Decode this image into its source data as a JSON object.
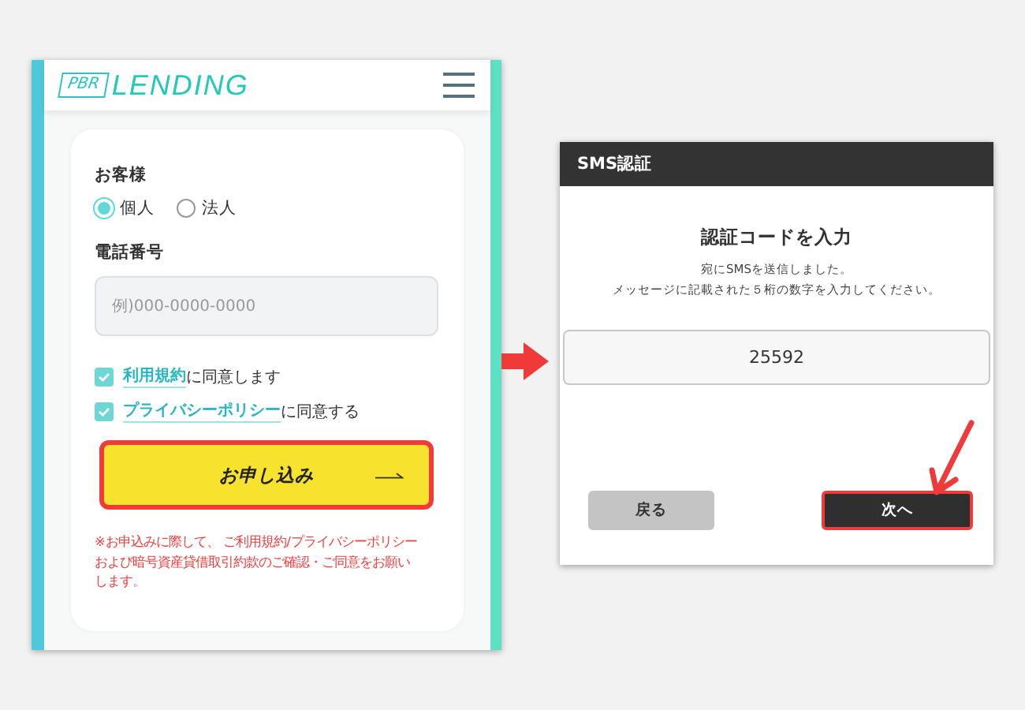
{
  "left_screen": {
    "logo_badge": "PBR",
    "logo_text": "LENDING",
    "customer_label": "お客様",
    "customer_types": [
      {
        "label": "個人",
        "selected": true
      },
      {
        "label": "法人",
        "selected": false
      }
    ],
    "phone_label": "電話番号",
    "phone_field": {
      "placeholder": "例)000-0000-0000"
    },
    "agreements": [
      {
        "link": "利用規約",
        "text": "に同意します",
        "checked": true
      },
      {
        "link": "プライバシーポリシー",
        "text": "に同意する",
        "checked": true
      }
    ],
    "apply_button": {
      "label": "お申し込み",
      "highlighted": true
    },
    "notice": "※お申込みに際して、 ご利用規約/プライバシーポリシーおよび暗号資産貸借取引約款のご確認・ご同意をお願いします。"
  },
  "right_screen": {
    "title": "SMS認証",
    "heading": "認証コードを入力",
    "message_lines": [
      "宛にSMSを送信しました。",
      "メッセージに記載された５桁の数字を入力してください。"
    ],
    "code_field": {
      "value": "25592"
    },
    "buttons": [
      {
        "label": "戻る",
        "kind": "secondary",
        "highlighted": false
      },
      {
        "label": "次へ",
        "kind": "primary",
        "highlighted": true
      }
    ]
  }
}
